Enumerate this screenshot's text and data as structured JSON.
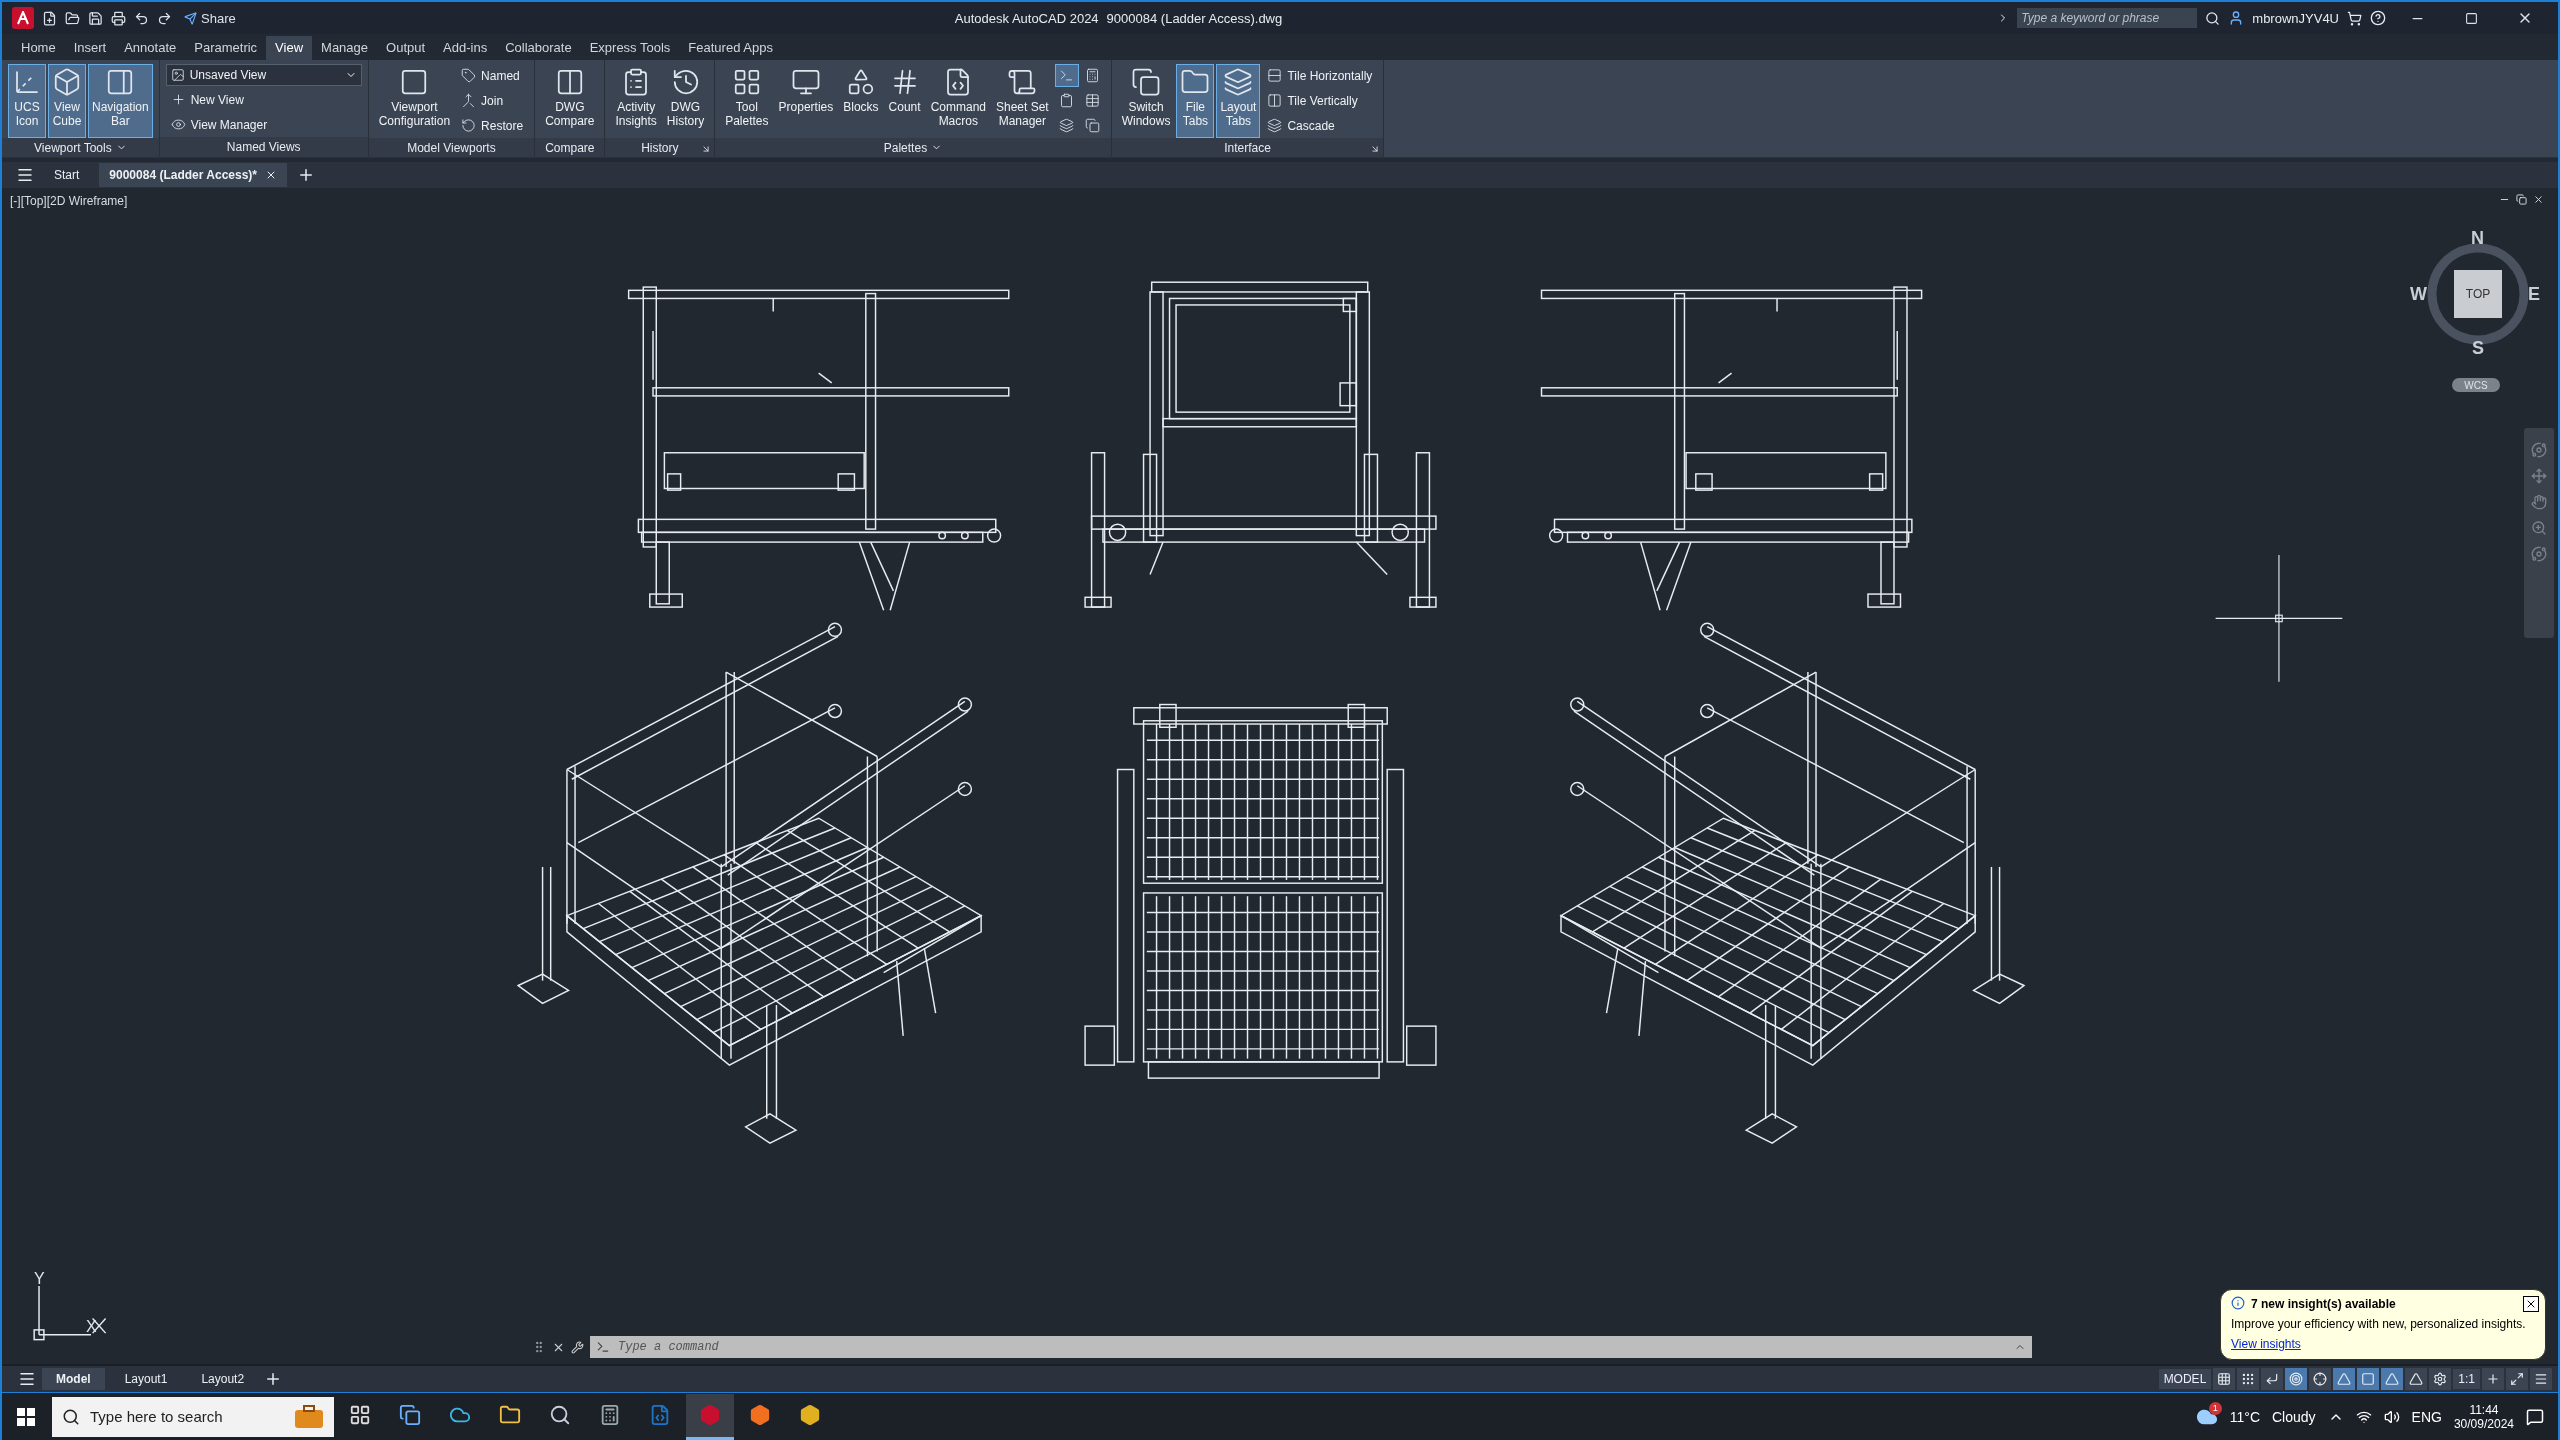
{
  "title_bar": {
    "share": "Share",
    "app_title": "Autodesk AutoCAD 2024",
    "file_name": "9000084 (Ladder Access).dwg",
    "search": {
      "placeholder": "Type a keyword or phrase"
    },
    "user": "mbrownJYV4U"
  },
  "ribbon_tabs": [
    {
      "label": "Home",
      "selected": false
    },
    {
      "label": "Insert",
      "selected": false
    },
    {
      "label": "Annotate",
      "selected": false
    },
    {
      "label": "Parametric",
      "selected": false
    },
    {
      "label": "View",
      "selected": true
    },
    {
      "label": "Manage",
      "selected": false
    },
    {
      "label": "Output",
      "selected": false
    },
    {
      "label": "Add-ins",
      "selected": false
    },
    {
      "label": "Collaborate",
      "selected": false
    },
    {
      "label": "Express Tools",
      "selected": false
    },
    {
      "label": "Featured Apps",
      "selected": false
    }
  ],
  "ribbon_panels": [
    {
      "title": "Viewport Tools",
      "has_menu": true,
      "has_launcher": false,
      "items": [
        {
          "kind": "large",
          "label": "UCS\nIcon",
          "selected": true
        },
        {
          "kind": "large",
          "label": "View\nCube",
          "selected": true
        },
        {
          "kind": "large",
          "label": "Navigation\nBar",
          "selected": true
        }
      ]
    },
    {
      "title": "Named Views",
      "has_menu": false,
      "has_launcher": false,
      "items": [
        {
          "kind": "dropdown",
          "label": "Unsaved View",
          "selected": false
        },
        {
          "kind": "small",
          "label": "New View",
          "selected": false
        },
        {
          "kind": "small",
          "label": "View Manager",
          "selected": false
        }
      ]
    },
    {
      "title": "Model Viewports",
      "has_menu": false,
      "has_launcher": false,
      "items": [
        {
          "kind": "large",
          "label": "Viewport\nConfiguration",
          "selected": false
        },
        {
          "kind": "small",
          "label": "Named",
          "selected": false
        },
        {
          "kind": "small",
          "label": "Join",
          "selected": false
        },
        {
          "kind": "small",
          "label": "Restore",
          "selected": false
        }
      ]
    },
    {
      "title": "Compare",
      "has_menu": false,
      "has_launcher": false,
      "items": [
        {
          "kind": "large",
          "label": "DWG\nCompare",
          "selected": false
        }
      ]
    },
    {
      "title": "History",
      "has_menu": false,
      "has_launcher": true,
      "items": [
        {
          "kind": "large",
          "label": "Activity\nInsights",
          "selected": false
        },
        {
          "kind": "large",
          "label": "DWG\nHistory",
          "selected": false
        }
      ]
    },
    {
      "title": "Palettes",
      "has_menu": true,
      "has_launcher": false,
      "items": [
        {
          "kind": "large",
          "label": "Tool\nPalettes",
          "selected": false
        },
        {
          "kind": "large",
          "label": "Properties",
          "selected": false
        },
        {
          "kind": "large",
          "label": "Blocks",
          "selected": false
        },
        {
          "kind": "large",
          "label": "Count",
          "selected": false
        },
        {
          "kind": "large",
          "label": "Command\nMacros",
          "selected": false
        },
        {
          "kind": "large",
          "label": "Sheet Set\nManager",
          "selected": false
        },
        {
          "kind": "icon",
          "selected": true
        },
        {
          "kind": "icon",
          "selected": false
        },
        {
          "kind": "icon",
          "selected": false
        },
        {
          "kind": "icon",
          "selected": false
        },
        {
          "kind": "icon",
          "selected": false
        },
        {
          "kind": "icon",
          "selected": false
        }
      ]
    },
    {
      "title": "Interface",
      "has_menu": false,
      "has_launcher": true,
      "items": [
        {
          "kind": "large",
          "label": "Switch\nWindows",
          "selected": false
        },
        {
          "kind": "large",
          "label": "File\nTabs",
          "selected": true
        },
        {
          "kind": "large",
          "label": "Layout\nTabs",
          "selected": true
        },
        {
          "kind": "small",
          "label": "Tile Horizontally",
          "selected": false
        },
        {
          "kind": "small",
          "label": "Tile Vertically",
          "selected": false
        },
        {
          "kind": "small",
          "label": "Cascade",
          "selected": false
        }
      ]
    }
  ],
  "file_tabs": [
    {
      "label": "Start",
      "selected": false,
      "closable": false
    },
    {
      "label": "9000084 (Ladder Access)*",
      "selected": true,
      "closable": true
    }
  ],
  "viewport": {
    "label": "[-][Top][2D Wireframe]",
    "viewcube": {
      "north": "N",
      "south": "S",
      "east": "E",
      "west": "W",
      "face": "TOP",
      "ucs": "WCS"
    },
    "ucs_icon": {
      "x": "X",
      "y": "Y"
    }
  },
  "command_line": {
    "placeholder": "Type a command"
  },
  "layout_tabs": [
    {
      "label": "Model",
      "selected": true
    },
    {
      "label": "Layout1",
      "selected": false
    },
    {
      "label": "Layout2",
      "selected": false
    }
  ],
  "status_bar": {
    "model": "MODEL",
    "scale": "1:1",
    "toggles": [
      {
        "selected": false
      },
      {
        "selected": false
      },
      {
        "selected": false
      },
      {
        "selected": true
      },
      {
        "selected": false
      },
      {
        "selected": true
      },
      {
        "selected": true
      },
      {
        "selected": true
      },
      {
        "selected": false
      },
      {
        "selected": false
      }
    ]
  },
  "notification": {
    "title": "7 new insight(s) available",
    "body": "Improve your efficiency with new, personalized insights.",
    "link": "View insights"
  },
  "taskbar": {
    "search": {
      "placeholder": "Type here to search"
    },
    "apps": [
      {
        "selected": false
      },
      {
        "selected": false
      },
      {
        "selected": false
      },
      {
        "selected": false
      },
      {
        "selected": false
      },
      {
        "selected": false
      },
      {
        "selected": false
      },
      {
        "selected": true
      },
      {
        "selected": false
      },
      {
        "selected": false
      }
    ],
    "weather": {
      "temperature": "11°C",
      "condition": "Cloudy",
      "badge": "1"
    },
    "language": "ENG",
    "time": "11:44",
    "date": "30/09/2024"
  }
}
